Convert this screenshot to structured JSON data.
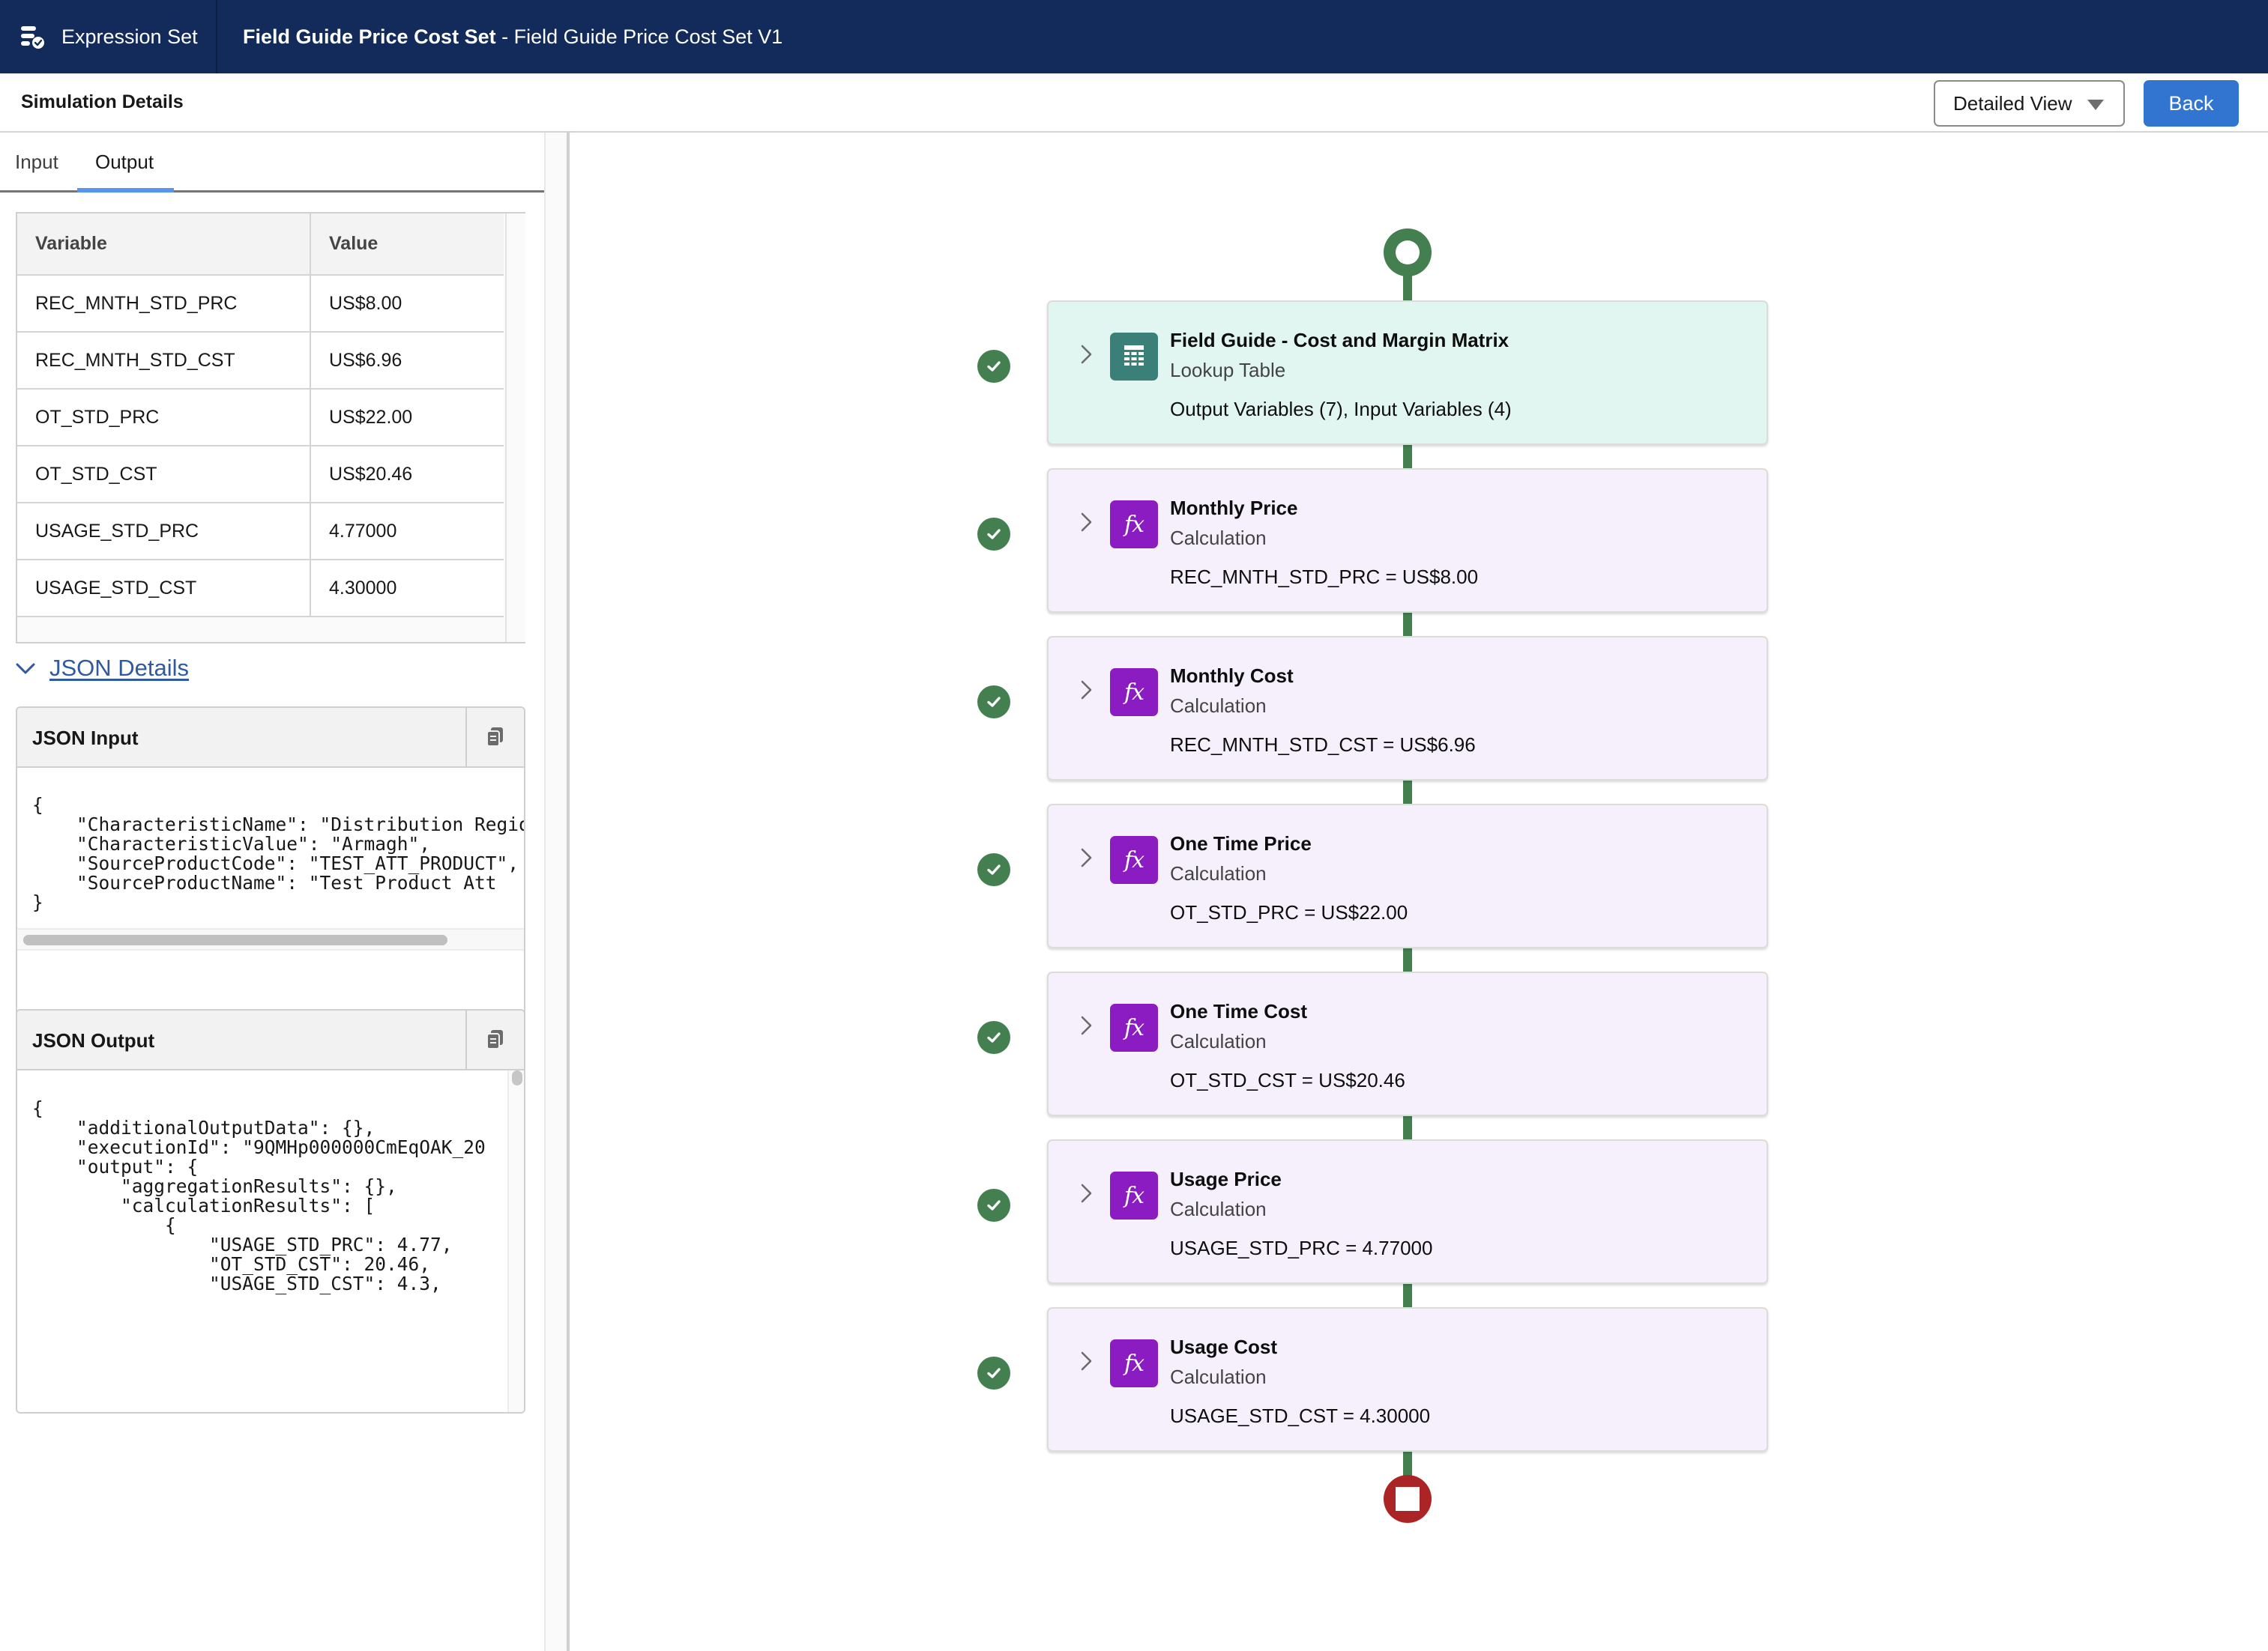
{
  "header": {
    "app_name": "Expression Set",
    "app_icon": "expression-set-icon",
    "record_name": "Field Guide Price Cost Set",
    "record_separator": " - ",
    "record_version": "Field Guide Price Cost Set V1"
  },
  "subheader": {
    "title": "Simulation Details",
    "view_select": {
      "value": "Detailed View"
    },
    "back_label": "Back"
  },
  "left_panel": {
    "tabs": [
      {
        "label": "Input",
        "active": false
      },
      {
        "label": "Output",
        "active": true
      }
    ],
    "table": {
      "columns": [
        "Variable",
        "Value"
      ],
      "rows": [
        {
          "variable": "REC_MNTH_STD_PRC",
          "value": "US$8.00"
        },
        {
          "variable": "REC_MNTH_STD_CST",
          "value": "US$6.96"
        },
        {
          "variable": "OT_STD_PRC",
          "value": "US$22.00"
        },
        {
          "variable": "OT_STD_CST",
          "value": "US$20.46"
        },
        {
          "variable": "USAGE_STD_PRC",
          "value": "4.77000"
        },
        {
          "variable": "USAGE_STD_CST",
          "value": "4.30000"
        }
      ]
    },
    "json_details": {
      "toggle_label": "JSON Details",
      "expanded": true,
      "input": {
        "title": "JSON Input",
        "copy_icon": "copy-icon",
        "text": "{\n    \"CharacteristicName\": \"Distribution Region\",\n    \"CharacteristicValue\": \"Armagh\",\n    \"SourceProductCode\": \"TEST_ATT_PRODUCT\",\n    \"SourceProductName\": \"Test Product Att\n}"
      },
      "output": {
        "title": "JSON Output",
        "copy_icon": "copy-icon",
        "text": "{\n    \"additionalOutputData\": {},\n    \"executionId\": \"9QMHp000000CmEqOAK_20\n    \"output\": {\n        \"aggregationResults\": {},\n        \"calculationResults\": [\n            {\n                \"USAGE_STD_PRC\": 4.77,\n                \"OT_STD_CST\": 20.46,\n                \"USAGE_STD_CST\": 4.3,"
      }
    }
  },
  "flow": {
    "start_node": "start",
    "end_node": "end",
    "steps": [
      {
        "title": "Field Guide - Cost and Margin Matrix",
        "type": "Lookup Table",
        "detail": "Output Variables (7), Input Variables (4)",
        "icon": "lookup-table-icon",
        "status": "success"
      },
      {
        "title": "Monthly Price",
        "type": "Calculation",
        "detail": "REC_MNTH_STD_PRC = US$8.00",
        "icon": "fx-icon",
        "status": "success"
      },
      {
        "title": "Monthly Cost",
        "type": "Calculation",
        "detail": "REC_MNTH_STD_CST = US$6.96",
        "icon": "fx-icon",
        "status": "success"
      },
      {
        "title": "One Time Price",
        "type": "Calculation",
        "detail": "OT_STD_PRC = US$22.00",
        "icon": "fx-icon",
        "status": "success"
      },
      {
        "title": "One Time Cost",
        "type": "Calculation",
        "detail": "OT_STD_CST = US$20.46",
        "icon": "fx-icon",
        "status": "success"
      },
      {
        "title": "Usage Price",
        "type": "Calculation",
        "detail": "USAGE_STD_PRC = 4.77000",
        "icon": "fx-icon",
        "status": "success"
      },
      {
        "title": "Usage Cost",
        "type": "Calculation",
        "detail": "USAGE_STD_CST = 4.30000",
        "icon": "fx-icon",
        "status": "success"
      }
    ],
    "fx_glyph": "fx"
  },
  "colors": {
    "header_bg": "#132b5b",
    "brand_button": "#3275d1",
    "tab_active": "#5895ee",
    "flow_success": "#447f50",
    "flow_end": "#ac2526",
    "lookup_card_bg": "#e2f6f1",
    "calc_card_bg": "#f5f0fc",
    "calc_icon_bg": "#8b1cc2",
    "lookup_icon_bg": "#3a7f78",
    "link": "#2f5aa0"
  }
}
